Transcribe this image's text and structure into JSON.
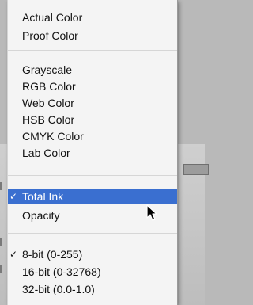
{
  "menu": {
    "group1": [
      {
        "label": "Actual Color",
        "checked": false
      },
      {
        "label": "Proof Color",
        "checked": false
      }
    ],
    "group2": [
      {
        "label": "Grayscale",
        "checked": false
      },
      {
        "label": "RGB Color",
        "checked": false
      },
      {
        "label": "Web Color",
        "checked": false
      },
      {
        "label": "HSB Color",
        "checked": false
      },
      {
        "label": "CMYK Color",
        "checked": false
      },
      {
        "label": "Lab Color",
        "checked": false
      }
    ],
    "group3": [
      {
        "label": "Total Ink",
        "checked": true,
        "highlighted": true
      },
      {
        "label": "Opacity",
        "checked": false
      }
    ],
    "group4": [
      {
        "label": "8-bit (0-255)",
        "checked": true
      },
      {
        "label": "16-bit (0-32768)",
        "checked": false
      },
      {
        "label": "32-bit (0.0-1.0)",
        "checked": false
      }
    ],
    "check_glyph": "✓"
  },
  "colors": {
    "menu_bg": "#f4f4f4",
    "highlight": "#3a6fd0",
    "highlight_text": "#ffffff",
    "text": "#111111"
  }
}
